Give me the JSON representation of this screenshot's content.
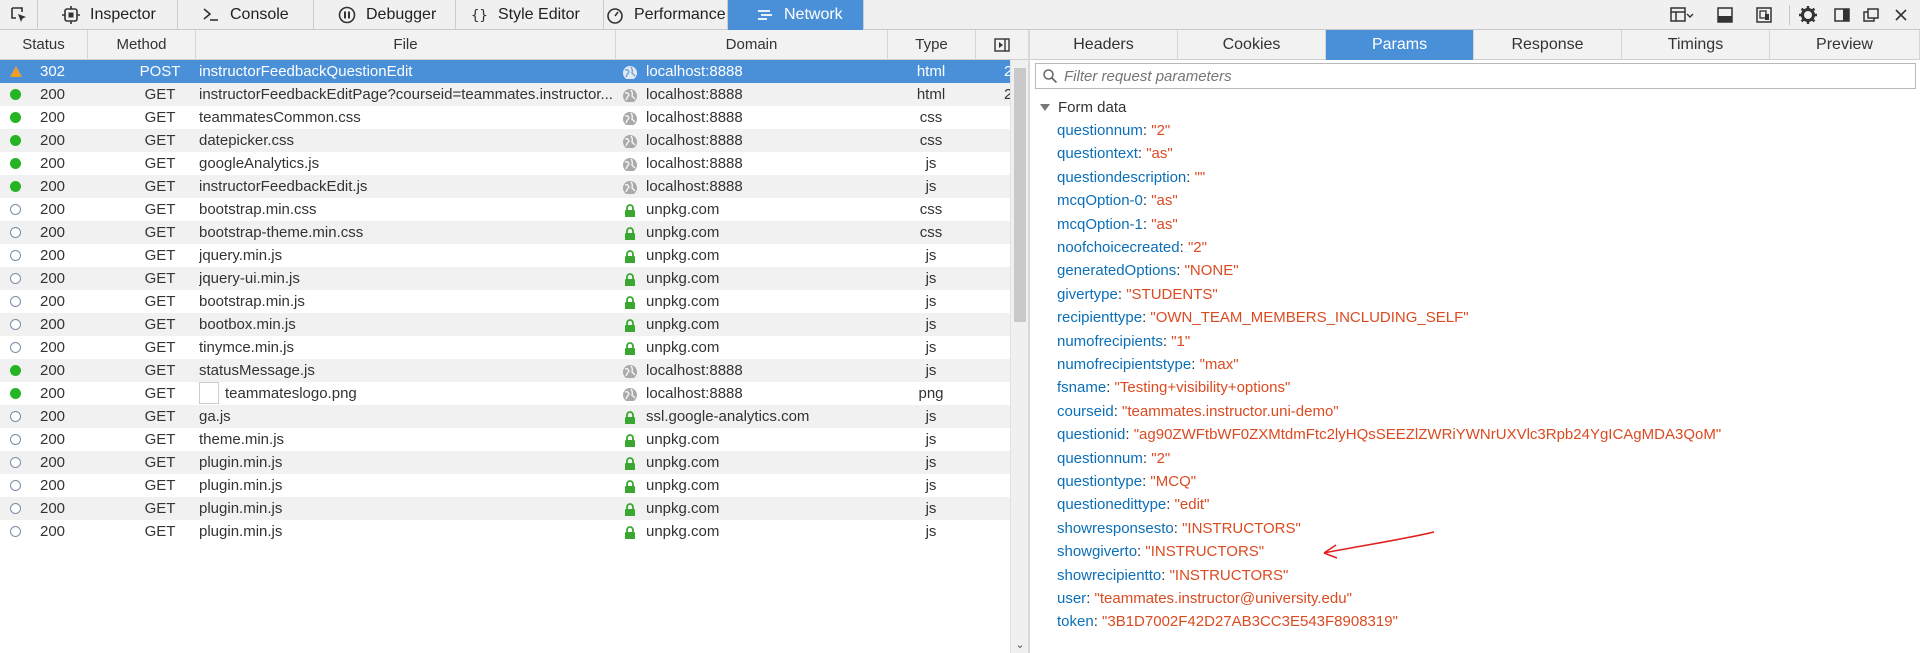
{
  "toolbar": {
    "tabs": [
      {
        "label": "Inspector",
        "icon": "inspector-icon"
      },
      {
        "label": "Console",
        "icon": "console-icon"
      },
      {
        "label": "Debugger",
        "icon": "debugger-icon"
      },
      {
        "label": "Style Editor",
        "icon": "style-editor-icon"
      },
      {
        "label": "Performance",
        "icon": "performance-icon"
      },
      {
        "label": "Network",
        "icon": "network-icon",
        "active": true
      }
    ],
    "right_icons": [
      "toggle-split-icon",
      "dock-bottom-icon",
      "responsive-icon",
      "settings-icon",
      "dock-side-icon",
      "undock-icon",
      "close-icon"
    ]
  },
  "request_list": {
    "columns": {
      "status": "Status",
      "method": "Method",
      "file": "File",
      "domain": "Domain",
      "type": "Type"
    },
    "rows": [
      {
        "status": "302",
        "method": "POST",
        "file": "instructorFeedbackQuestionEdit",
        "domain": "localhost:8888",
        "type": "html",
        "extra": "2",
        "indicator": "warning",
        "secure": false,
        "selected": true
      },
      {
        "status": "200",
        "method": "GET",
        "file": "instructorFeedbackEditPage?courseid=teammates.instructor....",
        "domain": "localhost:8888",
        "type": "html",
        "extra": "2",
        "indicator": "ok",
        "secure": false
      },
      {
        "status": "200",
        "method": "GET",
        "file": "teammatesCommon.css",
        "domain": "localhost:8888",
        "type": "css",
        "indicator": "ok",
        "secure": false
      },
      {
        "status": "200",
        "method": "GET",
        "file": "datepicker.css",
        "domain": "localhost:8888",
        "type": "css",
        "indicator": "ok",
        "secure": false
      },
      {
        "status": "200",
        "method": "GET",
        "file": "googleAnalytics.js",
        "domain": "localhost:8888",
        "type": "js",
        "indicator": "ok",
        "secure": false
      },
      {
        "status": "200",
        "method": "GET",
        "file": "instructorFeedbackEdit.js",
        "domain": "localhost:8888",
        "type": "js",
        "indicator": "ok",
        "secure": false
      },
      {
        "status": "200",
        "method": "GET",
        "file": "bootstrap.min.css",
        "domain": "unpkg.com",
        "type": "css",
        "indicator": "cached",
        "secure": true
      },
      {
        "status": "200",
        "method": "GET",
        "file": "bootstrap-theme.min.css",
        "domain": "unpkg.com",
        "type": "css",
        "indicator": "cached",
        "secure": true
      },
      {
        "status": "200",
        "method": "GET",
        "file": "jquery.min.js",
        "domain": "unpkg.com",
        "type": "js",
        "indicator": "cached",
        "secure": true
      },
      {
        "status": "200",
        "method": "GET",
        "file": "jquery-ui.min.js",
        "domain": "unpkg.com",
        "type": "js",
        "indicator": "cached",
        "secure": true
      },
      {
        "status": "200",
        "method": "GET",
        "file": "bootstrap.min.js",
        "domain": "unpkg.com",
        "type": "js",
        "indicator": "cached",
        "secure": true
      },
      {
        "status": "200",
        "method": "GET",
        "file": "bootbox.min.js",
        "domain": "unpkg.com",
        "type": "js",
        "indicator": "cached",
        "secure": true
      },
      {
        "status": "200",
        "method": "GET",
        "file": "tinymce.min.js",
        "domain": "unpkg.com",
        "type": "js",
        "indicator": "cached",
        "secure": true
      },
      {
        "status": "200",
        "method": "GET",
        "file": "statusMessage.js",
        "domain": "localhost:8888",
        "type": "js",
        "indicator": "ok",
        "secure": false
      },
      {
        "status": "200",
        "method": "GET",
        "file": "teammateslogo.png",
        "domain": "localhost:8888",
        "type": "png",
        "indicator": "ok",
        "secure": false,
        "thumbnail": true
      },
      {
        "status": "200",
        "method": "GET",
        "file": "ga.js",
        "domain": "ssl.google-analytics.com",
        "type": "js",
        "indicator": "cached",
        "secure": true
      },
      {
        "status": "200",
        "method": "GET",
        "file": "theme.min.js",
        "domain": "unpkg.com",
        "type": "js",
        "indicator": "cached",
        "secure": true
      },
      {
        "status": "200",
        "method": "GET",
        "file": "plugin.min.js",
        "domain": "unpkg.com",
        "type": "js",
        "indicator": "cached",
        "secure": true
      },
      {
        "status": "200",
        "method": "GET",
        "file": "plugin.min.js",
        "domain": "unpkg.com",
        "type": "js",
        "indicator": "cached",
        "secure": true
      },
      {
        "status": "200",
        "method": "GET",
        "file": "plugin.min.js",
        "domain": "unpkg.com",
        "type": "js",
        "indicator": "cached",
        "secure": true
      },
      {
        "status": "200",
        "method": "GET",
        "file": "plugin.min.js",
        "domain": "unpkg.com",
        "type": "js",
        "indicator": "cached",
        "secure": true
      }
    ]
  },
  "details": {
    "tabs": [
      "Headers",
      "Cookies",
      "Params",
      "Response",
      "Timings",
      "Preview"
    ],
    "active_tab": "Params",
    "filter_placeholder": "Filter request parameters",
    "section_title": "Form data",
    "params": [
      {
        "key": "questionnum",
        "value": "\"2\""
      },
      {
        "key": "questiontext",
        "value": "\"as\""
      },
      {
        "key": "questiondescription",
        "value": "\"\""
      },
      {
        "key": "mcqOption-0",
        "value": "\"as\""
      },
      {
        "key": "mcqOption-1",
        "value": "\"as\""
      },
      {
        "key": "noofchoicecreated",
        "value": "\"2\""
      },
      {
        "key": "generatedOptions",
        "value": "\"NONE\""
      },
      {
        "key": "givertype",
        "value": "\"STUDENTS\""
      },
      {
        "key": "recipienttype",
        "value": "\"OWN_TEAM_MEMBERS_INCLUDING_SELF\""
      },
      {
        "key": "numofrecipients",
        "value": "\"1\""
      },
      {
        "key": "numofrecipientstype",
        "value": "\"max\""
      },
      {
        "key": "fsname",
        "value": "\"Testing+visibility+options\""
      },
      {
        "key": "courseid",
        "value": "\"teammates.instructor.uni-demo\""
      },
      {
        "key": "questionid",
        "value": "\"ag90ZWFtbWF0ZXMtdmFtc2lyHQsSEEZlZWRiYWNrUXVlc3Rpb24YgICAgMDA3QoM\""
      },
      {
        "key": "questionnum",
        "value": "\"2\""
      },
      {
        "key": "questiontype",
        "value": "\"MCQ\""
      },
      {
        "key": "questionedittype",
        "value": "\"edit\""
      },
      {
        "key": "showresponsesto",
        "value": "\"INSTRUCTORS\""
      },
      {
        "key": "showgiverto",
        "value": "\"INSTRUCTORS\""
      },
      {
        "key": "showrecipientto",
        "value": "\"INSTRUCTORS\""
      },
      {
        "key": "user",
        "value": "\"teammates.instructor@university.edu\""
      },
      {
        "key": "token",
        "value": "\"3B1D7002F42D27AB3CC3E543F8908319\""
      }
    ]
  },
  "colors": {
    "accent": "#4a90d9",
    "ok": "#26b324",
    "warning": "#e8a028",
    "param_key": "#0b6fb8",
    "param_value": "#db4b22",
    "annotation": "#e02020"
  }
}
